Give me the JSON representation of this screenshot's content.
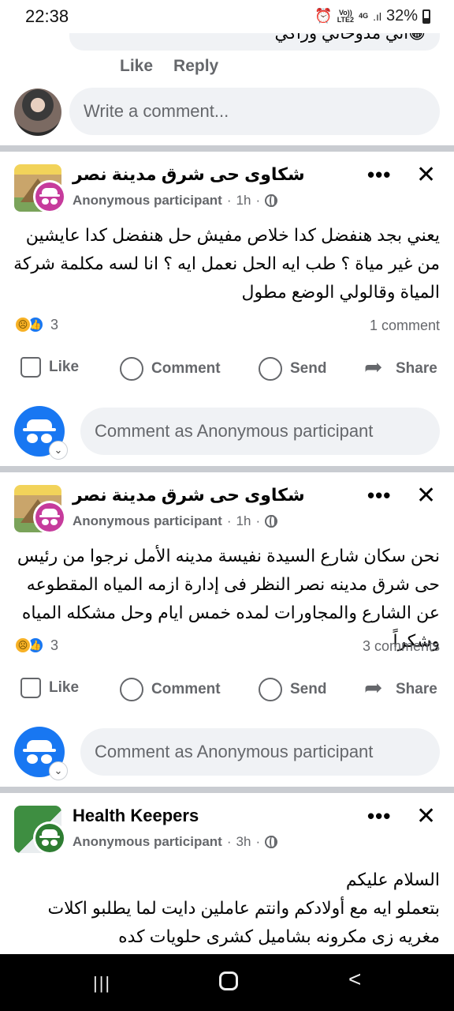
{
  "status_bar": {
    "time": "22:38",
    "network_top": "Vo))",
    "network_bottom": "LTE2",
    "net_type": "4G",
    "battery": "32%"
  },
  "previous_comment": {
    "text": "😁اتي مدوخاني وراكي",
    "like": "Like",
    "reply": "Reply"
  },
  "write_comment": {
    "placeholder": "Write a comment..."
  },
  "posts": [
    {
      "group": "شكاوى حى شرق مدينة نصر",
      "author": "Anonymous participant",
      "time": "1h",
      "body": "يعني بجد هنفضل كدا خلاص مفيش حل هنفضل كدا عايشين من غير مياة ؟ طب ايه الحل نعمل ايه ؟ انا لسه مكلمة شركة المياة وقالولي الوضع مطول",
      "reaction_count": "3",
      "comment_count": "1 comment",
      "actions": {
        "like": "Like",
        "comment": "Comment",
        "send": "Send",
        "share": "Share"
      },
      "comment_as": "Comment as Anonymous participant"
    },
    {
      "group": "شكاوى حى شرق مدينة نصر",
      "author": "Anonymous participant",
      "time": "1h",
      "body": "نحن سكان شارع السيدة نفيسة مدينه الأمل نرجوا من رئيس حى شرق مدينه نصر النظر فى إدارة ازمه المياه المقطوعه عن الشارع والمجاورات لمده خمس ايام وحل مشكله المياه وشكراً",
      "reaction_count": "3",
      "comment_count": "3 comments",
      "actions": {
        "like": "Like",
        "comment": "Comment",
        "send": "Send",
        "share": "Share"
      },
      "comment_as": "Comment as Anonymous participant"
    },
    {
      "group": "Health Keepers",
      "author": "Anonymous participant",
      "time": "3h",
      "body_line1": "السلام عليكم",
      "body_line2": "بتعملو ايه مع أولادكم وانتم عاملين دايت لما يطلبو اكلات مغريه زى مكرونه بشاميل كشرى حلويات كده"
    }
  ],
  "icons": {
    "more": "more-icon",
    "close": "close-icon",
    "globe": "globe-icon",
    "like": "like-icon",
    "comment": "comment-icon",
    "send": "whatsapp-send-icon",
    "share": "share-icon"
  },
  "nav_bar": {
    "recent": "|||",
    "back": "<"
  }
}
